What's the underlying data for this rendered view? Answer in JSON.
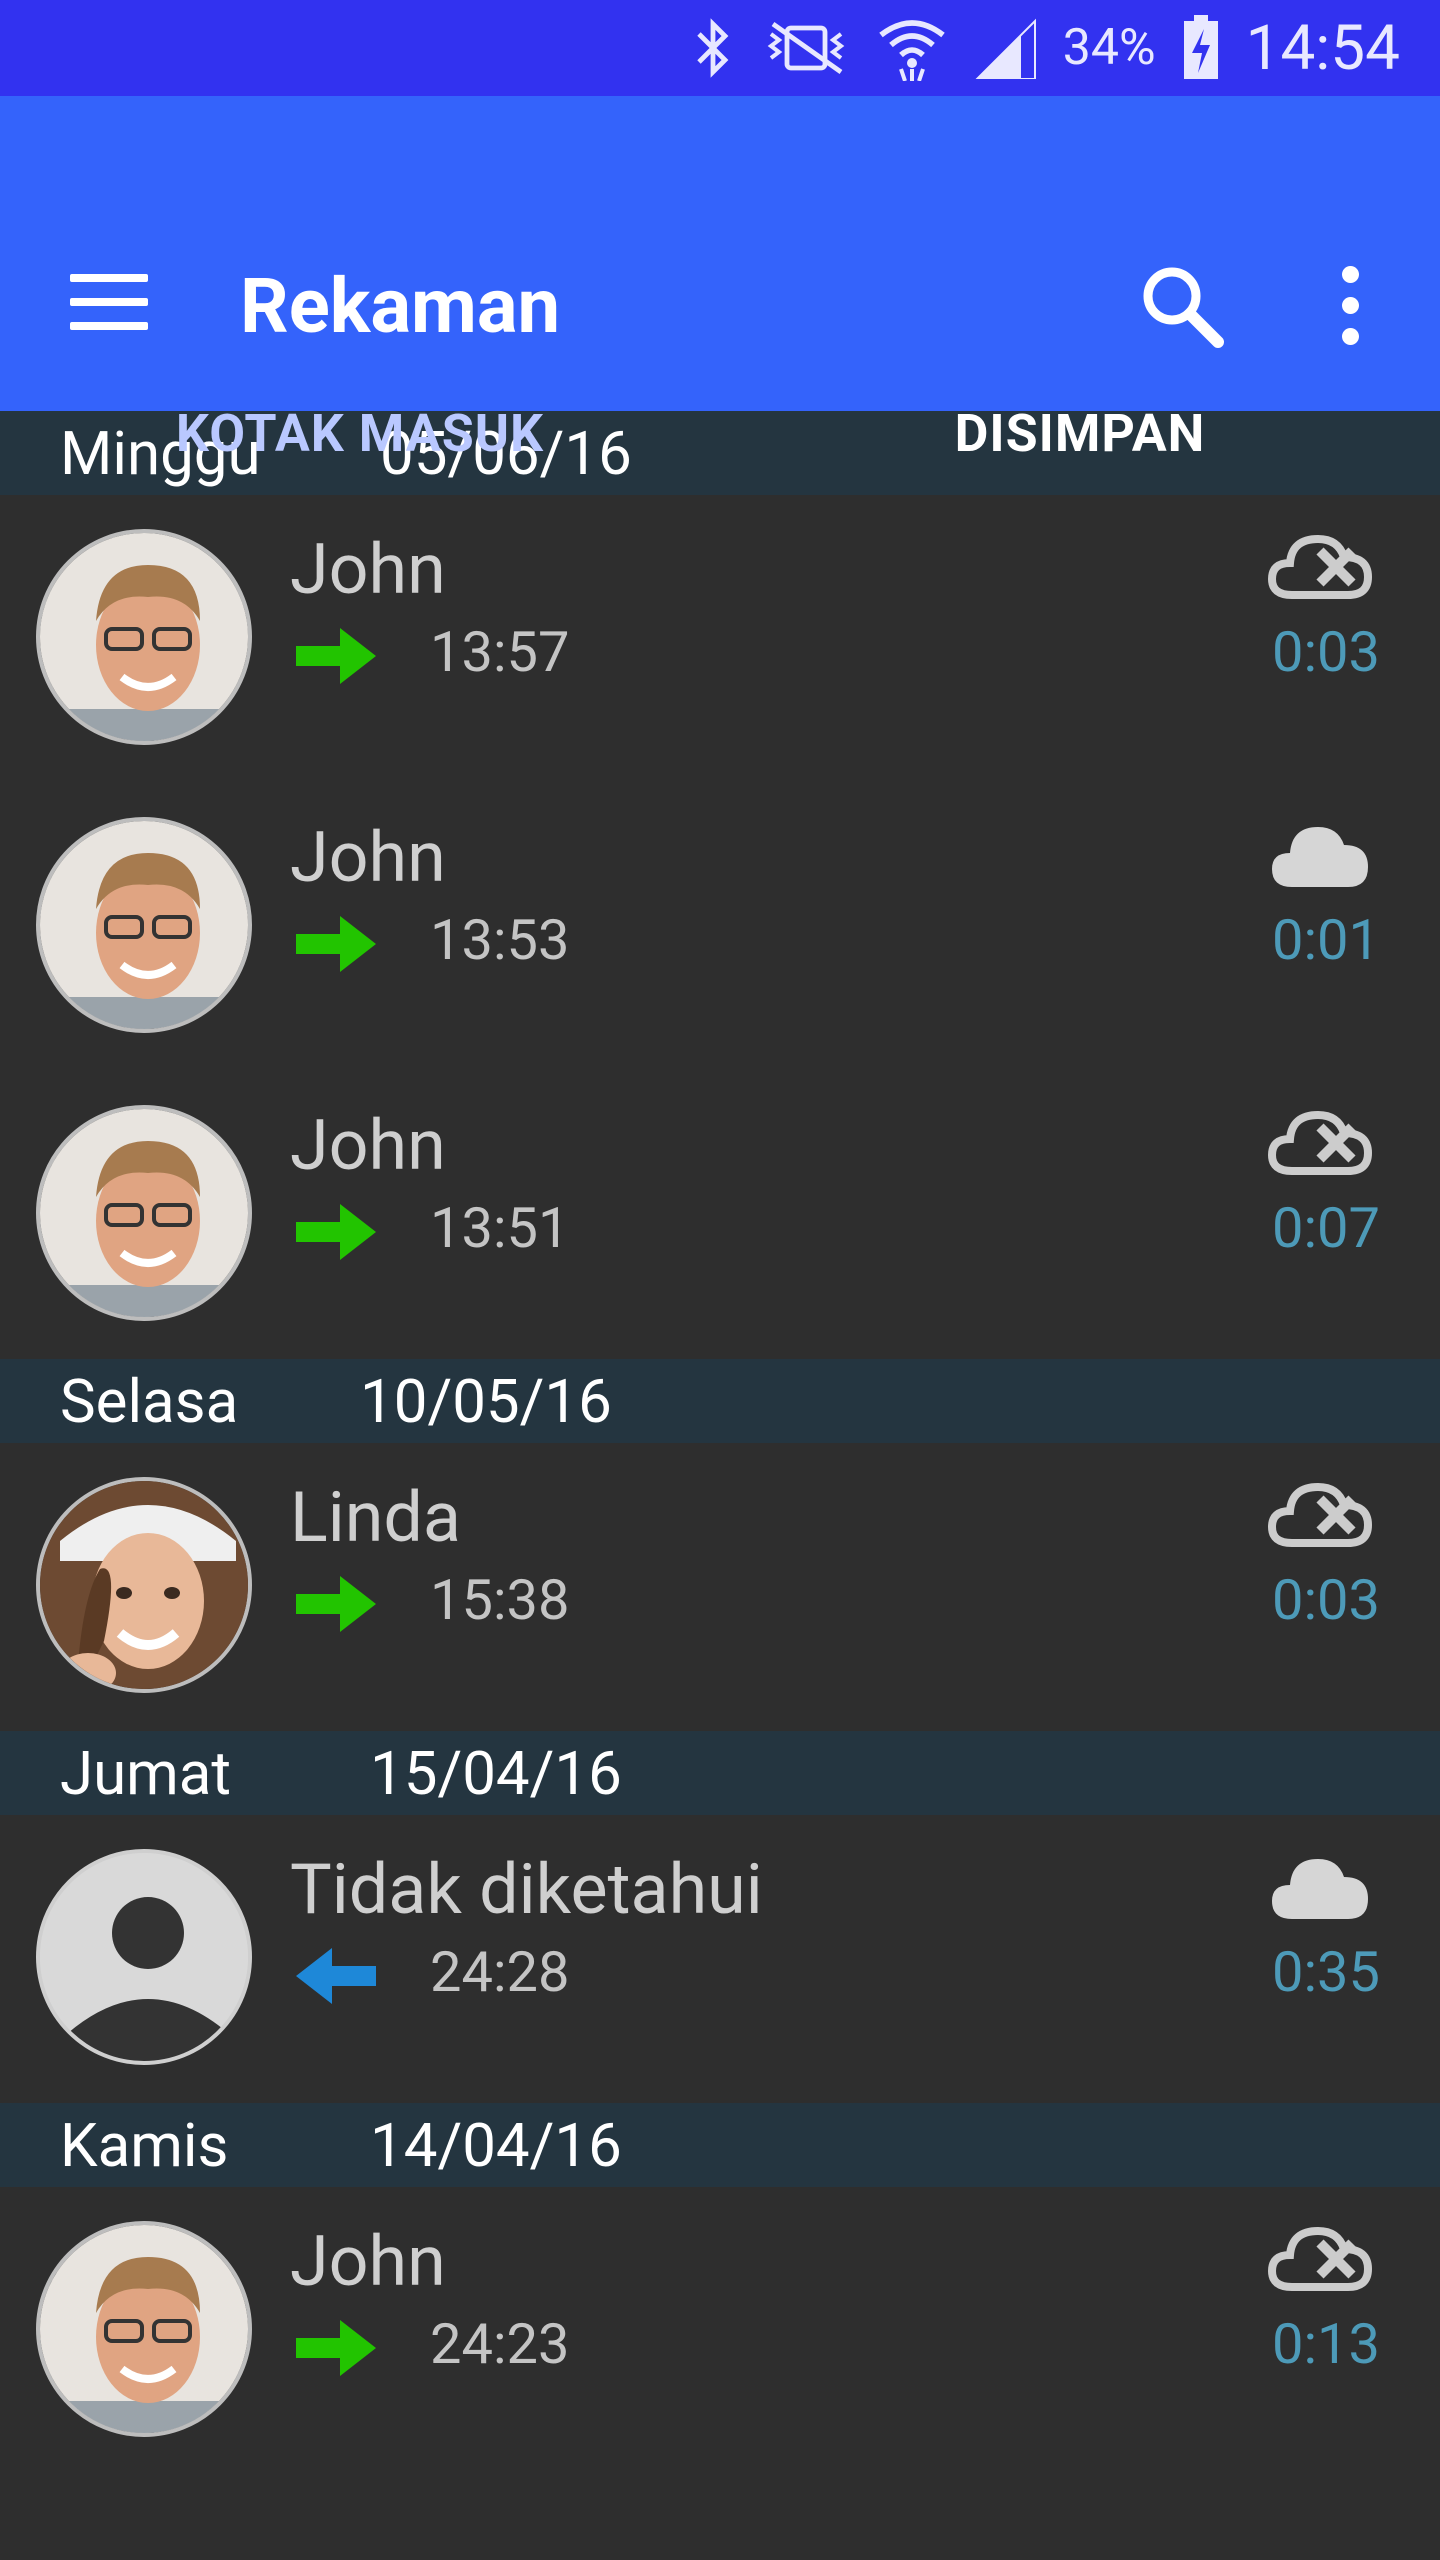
{
  "status_bar": {
    "battery": "34%",
    "time": "14:54"
  },
  "app_bar": {
    "title": "Rekaman"
  },
  "tabs": [
    {
      "label": "KOTAK MASUK",
      "active": false
    },
    {
      "label": "DISIMPAN",
      "active": true
    }
  ],
  "sections": [
    {
      "day": "Minggu",
      "date": "05/06/16",
      "items": [
        {
          "name": "John",
          "direction": "outgoing",
          "time": "13:57",
          "cloud": "cloud-off-icon",
          "duration": "0:03",
          "avatar": "john"
        },
        {
          "name": "John",
          "direction": "outgoing",
          "time": "13:53",
          "cloud": "cloud-icon",
          "duration": "0:01",
          "avatar": "john"
        },
        {
          "name": "John",
          "direction": "outgoing",
          "time": "13:51",
          "cloud": "cloud-off-icon",
          "duration": "0:07",
          "avatar": "john"
        }
      ]
    },
    {
      "day": "Selasa",
      "date": "10/05/16",
      "items": [
        {
          "name": "Linda",
          "direction": "outgoing",
          "time": "15:38",
          "cloud": "cloud-off-icon",
          "duration": "0:03",
          "avatar": "linda"
        }
      ]
    },
    {
      "day": "Jumat",
      "date": "15/04/16",
      "items": [
        {
          "name": "Tidak diketahui",
          "direction": "incoming",
          "time": "24:28",
          "cloud": "cloud-icon",
          "duration": "0:35",
          "avatar": "unknown"
        }
      ]
    },
    {
      "day": "Kamis",
      "date": "14/04/16",
      "items": [
        {
          "name": "John",
          "direction": "outgoing",
          "time": "24:23",
          "cloud": "cloud-off-icon",
          "duration": "0:13",
          "avatar": "john"
        }
      ]
    }
  ],
  "colors": {
    "status_bar": "#3232f0",
    "app_bar": "#3463fb",
    "section_header": "#243540",
    "list_bg": "#2e2e2e",
    "outgoing_arrow": "#22c400",
    "incoming_arrow": "#1e88d8",
    "duration_text": "#4d9ab8"
  }
}
